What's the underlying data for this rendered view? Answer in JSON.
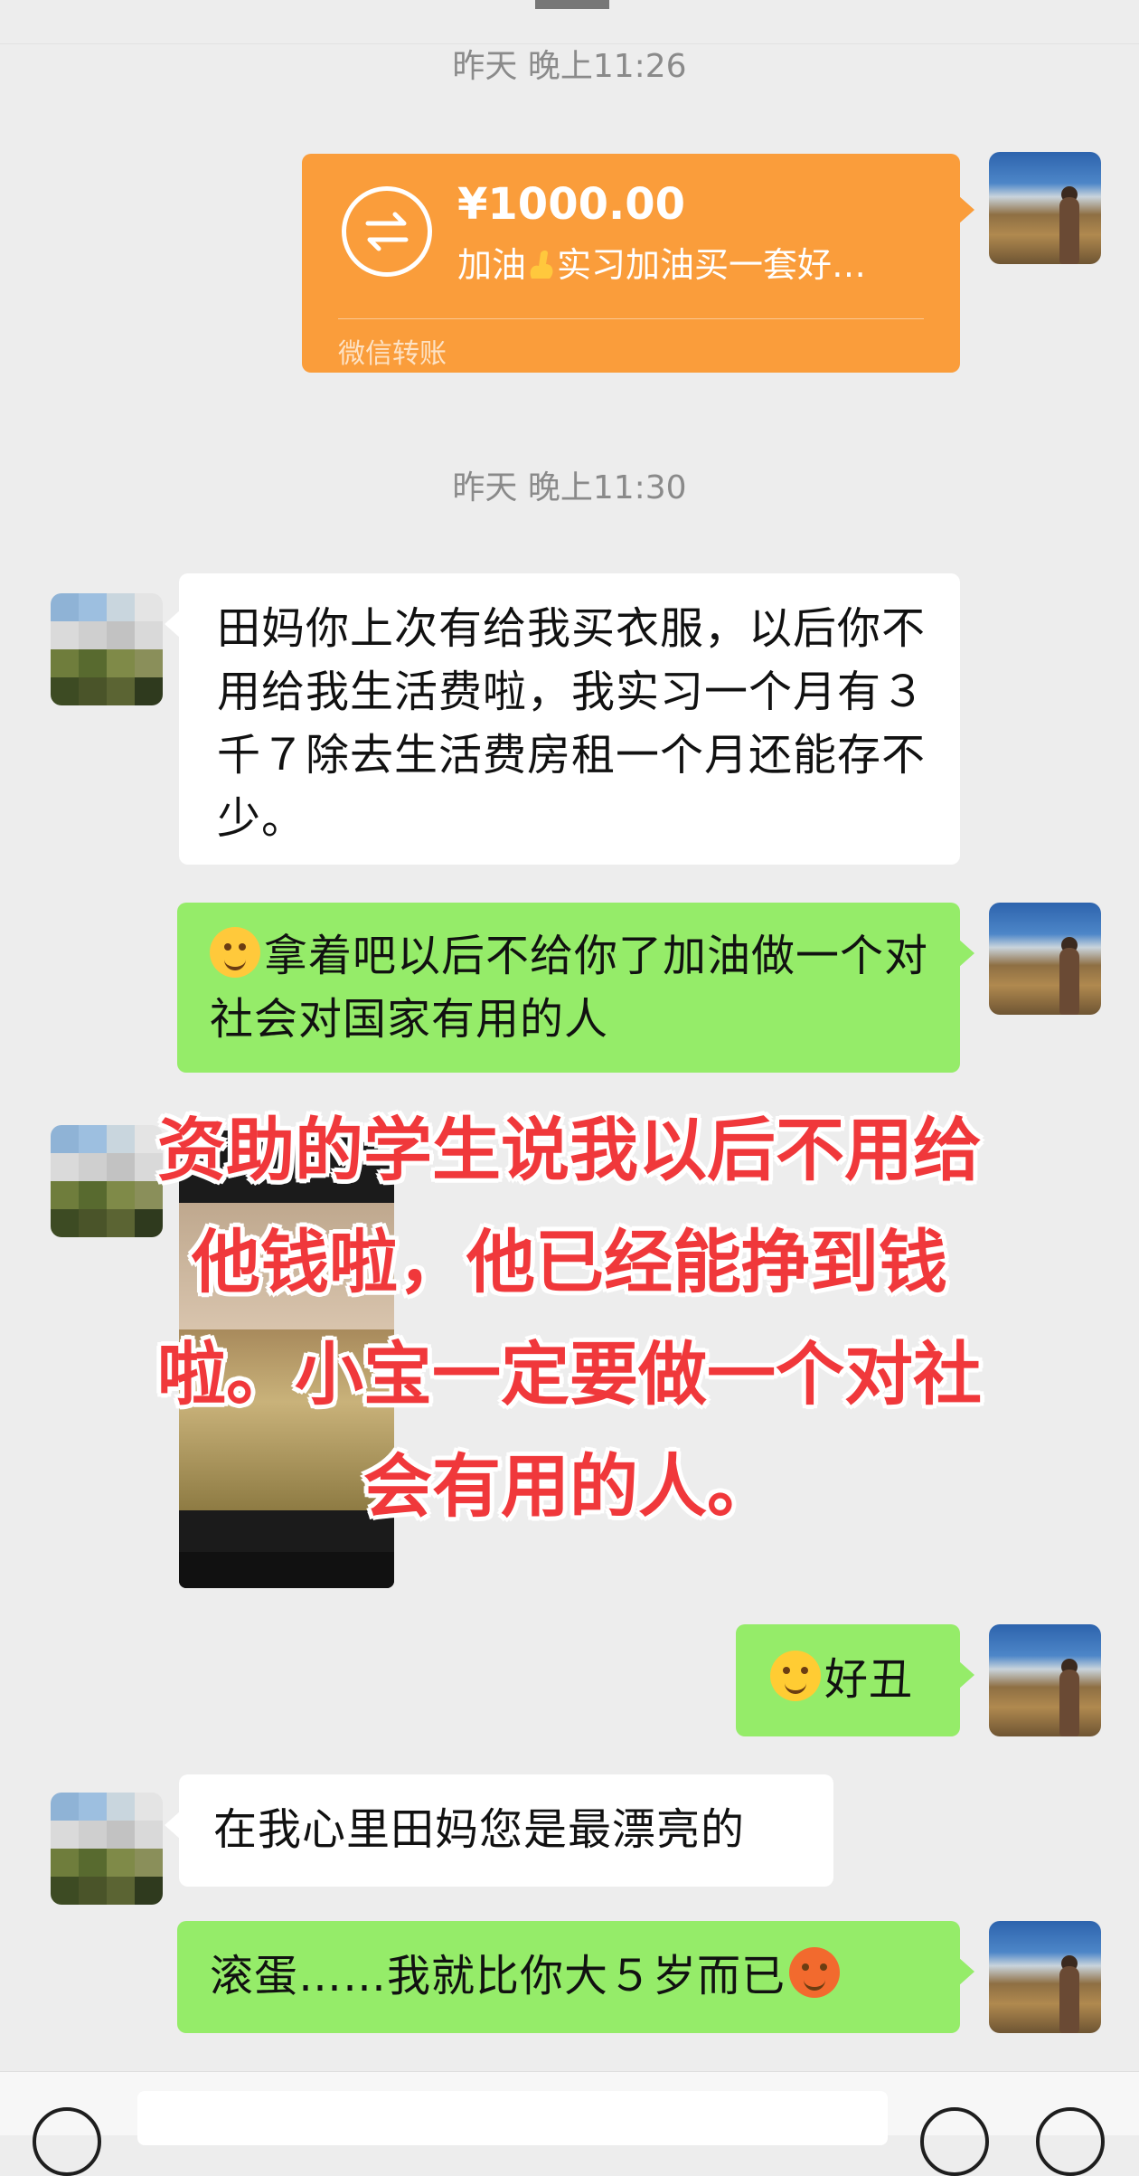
{
  "chat": {
    "messages": [
      {
        "timestamp": "昨天 晚上11:26"
      },
      {
        "transfer": {
          "amount": "¥1000.00",
          "memo_before_emoji": "加油",
          "memo_emoji": "flexed-biceps-icon",
          "memo_after_emoji": "实习加油买一套好…",
          "kind": "微信转账"
        }
      },
      {
        "timestamp": "昨天 晚上11:30"
      },
      {
        "text": "田妈你上次有给我买衣服，以后你不用给我生活费啦，我实习一个月有３千７除去生活费房租一个月还能存不少。"
      },
      {
        "emoji": "thinking-face-icon",
        "text": "拿着吧以后不给你了加油做一个对社会对国家有用的人"
      },
      {
        "emoji": "tears-of-joy-icon",
        "text": "好丑"
      },
      {
        "text": "在我心里田妈您是最漂亮的"
      },
      {
        "text": "滚蛋……我就比你大５岁而已",
        "emoji": "anxious-sweat-face-icon"
      }
    ]
  },
  "overlay": {
    "lines": [
      "资助的学生说我以后不用给",
      "他钱啦，他已经能挣到钱",
      "啦。小宝一定要做一个对社",
      "会有用的人。"
    ]
  },
  "colors": {
    "background": "#ededed",
    "sent_bubble": "#95ec69",
    "received_bubble": "#ffffff",
    "transfer_card": "#fa9d3b",
    "overlay_text": "#f0383b"
  }
}
